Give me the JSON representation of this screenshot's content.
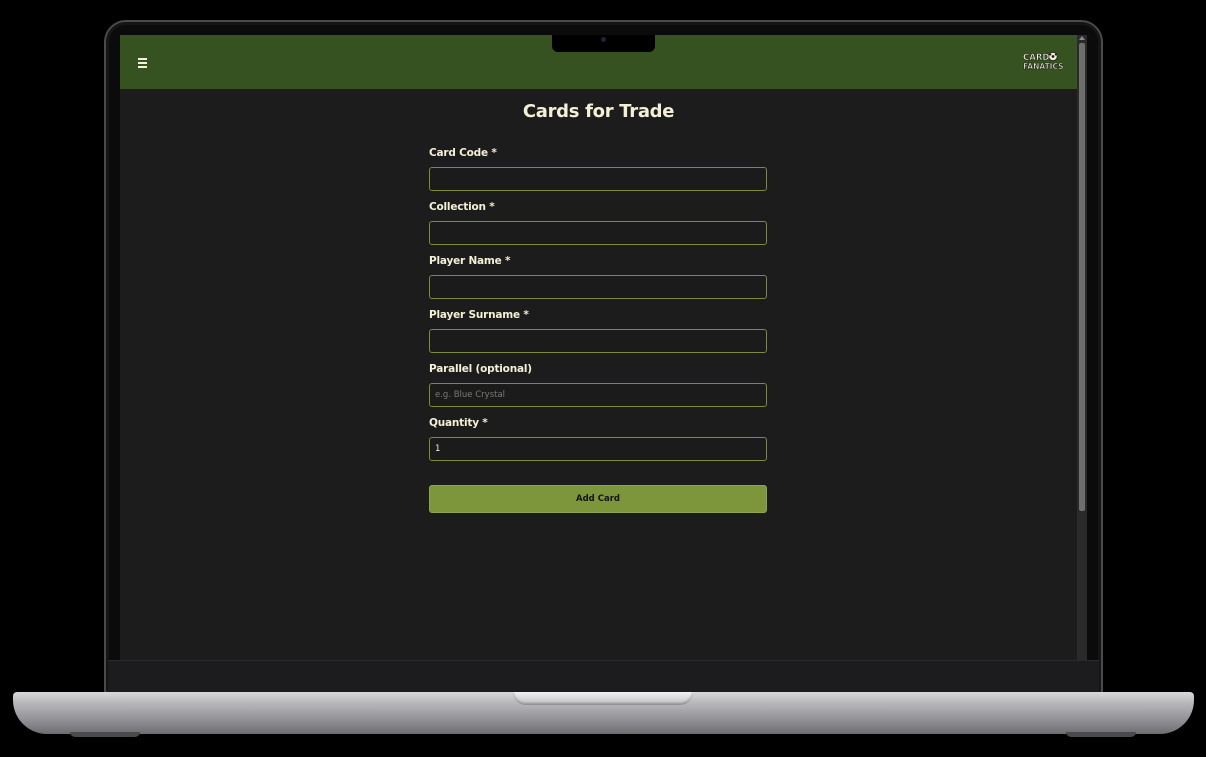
{
  "app": {
    "logo_text_line1": "CARD",
    "logo_text_line2": "FANATICS",
    "menu_icon": "hamburger-icon"
  },
  "page": {
    "title": "Cards for Trade"
  },
  "form": {
    "fields": [
      {
        "label": "Card Code *",
        "value": "",
        "placeholder": ""
      },
      {
        "label": "Collection *",
        "value": "",
        "placeholder": ""
      },
      {
        "label": "Player Name *",
        "value": "",
        "placeholder": ""
      },
      {
        "label": "Player Surname *",
        "value": "",
        "placeholder": ""
      },
      {
        "label": "Parallel (optional)",
        "value": "",
        "placeholder": "e.g. Blue Crystal"
      },
      {
        "label": "Quantity *",
        "value": "1",
        "placeholder": ""
      }
    ],
    "submit_label": "Add Card"
  },
  "colors": {
    "navbar": "#355220",
    "background": "#1b1c1b",
    "accent": "#7d963b",
    "text": "#f4f0d8",
    "input_border": "#7b8b3a"
  }
}
